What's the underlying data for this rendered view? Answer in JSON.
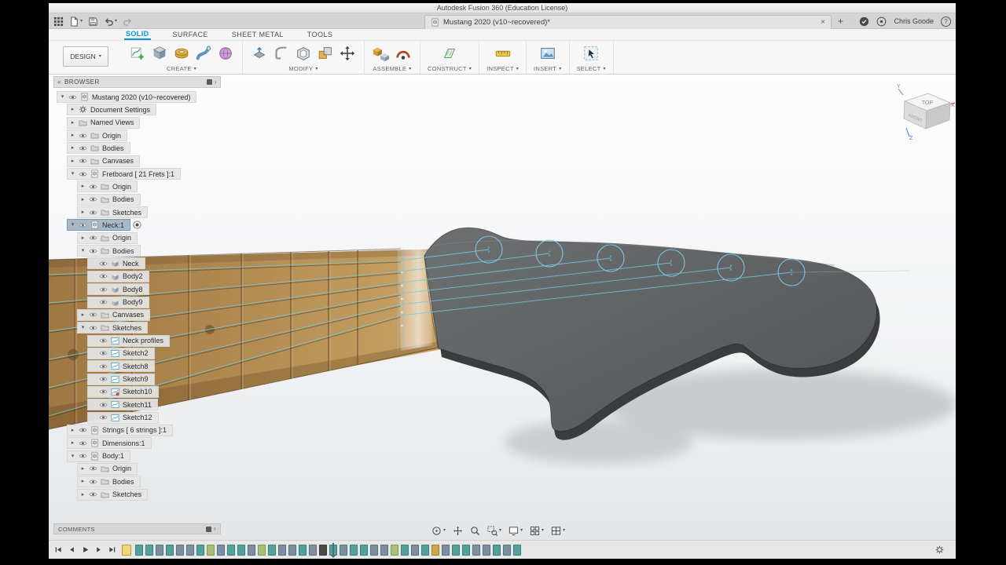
{
  "window": {
    "title": "Autodesk Fusion 360 (Education License)"
  },
  "glyphs": {
    "expanded": "▾",
    "collapsed": "▸",
    "caret": "▾",
    "collapse_panel": "«",
    "chevron": "›",
    "close": "×",
    "add": "+"
  },
  "qat": {
    "items": [
      {
        "name": "apps-grid",
        "caret": false
      },
      {
        "name": "file",
        "caret": true
      },
      {
        "name": "save",
        "caret": false
      },
      {
        "name": "undo",
        "caret": true
      },
      {
        "name": "redo",
        "caret": false,
        "disabled": true
      }
    ]
  },
  "doc_tab": {
    "title": "Mustang 2020 (v10~recovered)*"
  },
  "account": {
    "user": "Chris Goode",
    "help": "?"
  },
  "ribbon": {
    "tabs": [
      {
        "label": "SOLID",
        "active": true
      },
      {
        "label": "SURFACE",
        "active": false
      },
      {
        "label": "SHEET METAL",
        "active": false
      },
      {
        "label": "TOOLS",
        "active": false
      }
    ],
    "design_menu": "DESIGN",
    "groups": [
      {
        "label": "CREATE",
        "icons": [
          "sketch-create",
          "solid-box",
          "revolve-torus",
          "sweep-pipe",
          "form-sphere"
        ]
      },
      {
        "label": "MODIFY",
        "icons": [
          "press-pull",
          "fillet",
          "shell-box",
          "combine",
          "move-cross"
        ]
      },
      {
        "label": "ASSEMBLE",
        "icons": [
          "new-component",
          "joint"
        ]
      },
      {
        "label": "CONSTRUCT",
        "icons": [
          "construction-plane"
        ]
      },
      {
        "label": "INSPECT",
        "icons": [
          "measure"
        ]
      },
      {
        "label": "INSERT",
        "icons": [
          "insert-canvas"
        ]
      },
      {
        "label": "SELECT",
        "icons": [
          "select-cursor"
        ]
      }
    ]
  },
  "browser": {
    "header": "BROWSER",
    "items": [
      {
        "level": 0,
        "arrow": "open",
        "eye": true,
        "icon": "component",
        "label": "Mustang 2020 (v10~recovered)"
      },
      {
        "level": 1,
        "arrow": "closed",
        "eye": false,
        "icon": "gear",
        "label": "Document Settings"
      },
      {
        "level": 1,
        "arrow": "closed",
        "eye": false,
        "icon": "folder",
        "label": "Named Views"
      },
      {
        "level": 1,
        "arrow": "closed",
        "eye": true,
        "icon": "folder",
        "label": "Origin"
      },
      {
        "level": 1,
        "arrow": "closed",
        "eye": true,
        "icon": "folder",
        "label": "Bodies"
      },
      {
        "level": 1,
        "arrow": "closed",
        "eye": true,
        "icon": "folder",
        "label": "Canvases"
      },
      {
        "level": 1,
        "arrow": "open",
        "eye": true,
        "icon": "component",
        "label": "Fretboard [ 21 Frets ]:1"
      },
      {
        "level": 2,
        "arrow": "closed",
        "eye": true,
        "icon": "folder",
        "label": "Origin"
      },
      {
        "level": 2,
        "arrow": "closed",
        "eye": true,
        "icon": "folder",
        "label": "Bodies"
      },
      {
        "level": 2,
        "arrow": "closed",
        "eye": true,
        "icon": "folder",
        "label": "Sketches"
      },
      {
        "level": 1,
        "arrow": "open",
        "eye": true,
        "icon": "component",
        "label": "Neck:1",
        "selected": true,
        "radio": true
      },
      {
        "level": 2,
        "arrow": "closed",
        "eye": true,
        "icon": "folder",
        "label": "Origin"
      },
      {
        "level": 2,
        "arrow": "open",
        "eye": true,
        "icon": "folder",
        "label": "Bodies"
      },
      {
        "level": 3,
        "arrow": "none",
        "eye": true,
        "icon": "body",
        "label": "Neck"
      },
      {
        "level": 3,
        "arrow": "none",
        "eye": true,
        "icon": "body",
        "label": "Body2"
      },
      {
        "level": 3,
        "arrow": "none",
        "eye": true,
        "icon": "body",
        "label": "Body8"
      },
      {
        "level": 3,
        "arrow": "none",
        "eye": true,
        "icon": "body",
        "label": "Body9"
      },
      {
        "level": 2,
        "arrow": "closed",
        "eye": true,
        "icon": "folder",
        "label": "Canvases"
      },
      {
        "level": 2,
        "arrow": "open",
        "eye": true,
        "icon": "folder",
        "label": "Sketches"
      },
      {
        "level": 3,
        "arrow": "none",
        "eye": true,
        "icon": "sketch",
        "label": "Neck profiles"
      },
      {
        "level": 3,
        "arrow": "none",
        "eye": true,
        "icon": "sketch",
        "label": "Sketch2"
      },
      {
        "level": 3,
        "arrow": "none",
        "eye": true,
        "icon": "sketch",
        "label": "Sketch8"
      },
      {
        "level": 3,
        "arrow": "none",
        "eye": true,
        "icon": "sketch",
        "label": "Sketch9"
      },
      {
        "level": 3,
        "arrow": "none",
        "eye": true,
        "icon": "sketch-alert",
        "label": "Sketch10"
      },
      {
        "level": 3,
        "arrow": "none",
        "eye": true,
        "icon": "sketch",
        "label": "Sketch11"
      },
      {
        "level": 3,
        "arrow": "none",
        "eye": true,
        "icon": "sketch",
        "label": "Sketch12"
      },
      {
        "level": 1,
        "arrow": "closed",
        "eye": true,
        "icon": "component",
        "label": "Strings [ 6 strings ]:1"
      },
      {
        "level": 1,
        "arrow": "closed",
        "eye": true,
        "icon": "component",
        "label": "Dimensions:1"
      },
      {
        "level": 1,
        "arrow": "open",
        "eye": true,
        "icon": "component",
        "label": "Body:1"
      },
      {
        "level": 2,
        "arrow": "closed",
        "eye": true,
        "icon": "folder",
        "label": "Origin"
      },
      {
        "level": 2,
        "arrow": "closed",
        "eye": true,
        "icon": "folder",
        "label": "Bodies"
      },
      {
        "level": 2,
        "arrow": "closed",
        "eye": true,
        "icon": "folder",
        "label": "Sketches"
      }
    ]
  },
  "viewcube": {
    "top": "TOP",
    "front": "FRONT",
    "axis_x": "X",
    "axis_y": "Y",
    "axis_z": "Z"
  },
  "comments": {
    "label": "COMMENTS"
  },
  "navbar": {
    "items": [
      {
        "name": "orbit",
        "caret": true
      },
      {
        "name": "pan",
        "caret": false
      },
      {
        "name": "zoom",
        "caret": false
      },
      {
        "name": "zoom-window",
        "caret": true
      },
      {
        "name": "display-settings",
        "caret": true
      },
      {
        "name": "grid-settings",
        "caret": true
      },
      {
        "name": "viewports",
        "caret": true
      }
    ]
  },
  "timeline": {
    "playback": [
      "go-to-start",
      "step-back",
      "play",
      "step-forward",
      "go-to-end"
    ],
    "features": [
      "sk",
      "sk",
      "ft",
      "sk",
      "ft",
      "ft",
      "sk",
      "cn",
      "ft",
      "sk",
      "sk",
      "ft",
      "cn",
      "sk",
      "ft",
      "ft",
      "sk",
      "ft",
      "dk",
      "sk",
      "ft",
      "sk",
      "sk",
      "ft",
      "ft",
      "cn",
      "sk",
      "ft",
      "sk",
      "gd",
      "ft",
      "sk",
      "sk",
      "ft",
      "ft",
      "sk",
      "ft",
      "sk"
    ]
  },
  "colors": {
    "accent": "#0696d7",
    "sk": "#4fa39b",
    "ft": "#7b8fa3",
    "cn": "#a8bf77",
    "dk": "#4a4a4a",
    "gd": "#d2a54a",
    "wood": "#b18a52",
    "headstock": "#5f6163",
    "sketch_cyan": "#74cadf"
  }
}
